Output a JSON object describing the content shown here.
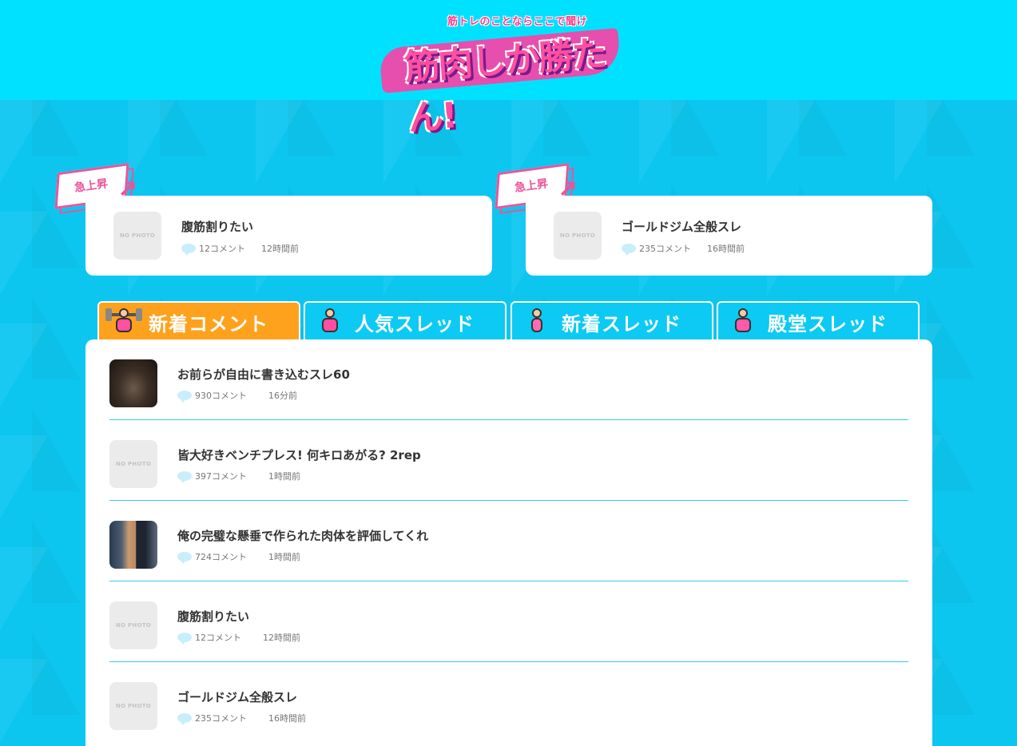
{
  "header": {
    "logo_tagline": "筋トレのことならここで聞け",
    "logo_main": "筋肉しか勝たん!"
  },
  "trending": {
    "badge_label": "急上昇",
    "items": [
      {
        "title": "腹筋割りたい",
        "comments": "12コメント",
        "time": "12時間前",
        "thumb": "NO PHOTO"
      },
      {
        "title": "ゴールドジム全般スレ",
        "comments": "235コメント",
        "time": "16時間前",
        "thumb": "NO PHOTO"
      }
    ]
  },
  "tabs": [
    {
      "label": "新着コメント",
      "icon": "barbell-lifter-icon",
      "active": true
    },
    {
      "label": "人気スレッド",
      "icon": "flexing-man-icon",
      "active": false
    },
    {
      "label": "新着スレッド",
      "icon": "runner-icon",
      "active": false
    },
    {
      "label": "殿堂スレッド",
      "icon": "trophy-man-icon",
      "active": false
    }
  ],
  "threads": [
    {
      "title": "お前らが自由に書き込むスレ60",
      "comments": "930コメント",
      "time": "16分前",
      "thumb": "photo"
    },
    {
      "title": "皆大好きベンチプレス! 何キロあがる? 2rep",
      "comments": "397コメント",
      "time": "1時間前",
      "thumb": "NO PHOTO"
    },
    {
      "title": "俺の完璧な懸垂で作られた肉体を評価してくれ",
      "comments": "724コメント",
      "time": "1時間前",
      "thumb": "photo"
    },
    {
      "title": "腹筋割りたい",
      "comments": "12コメント",
      "time": "12時間前",
      "thumb": "NO PHOTO"
    },
    {
      "title": "ゴールドジム全般スレ",
      "comments": "235コメント",
      "time": "16時間前",
      "thumb": "NO PHOTO"
    }
  ],
  "colors": {
    "header_bg": "#00e1ff",
    "body_bg": "#0ccaf3",
    "active_tab": "#fea21e",
    "badge_pink": "#e9559a",
    "divider": "#3cc8ea"
  }
}
